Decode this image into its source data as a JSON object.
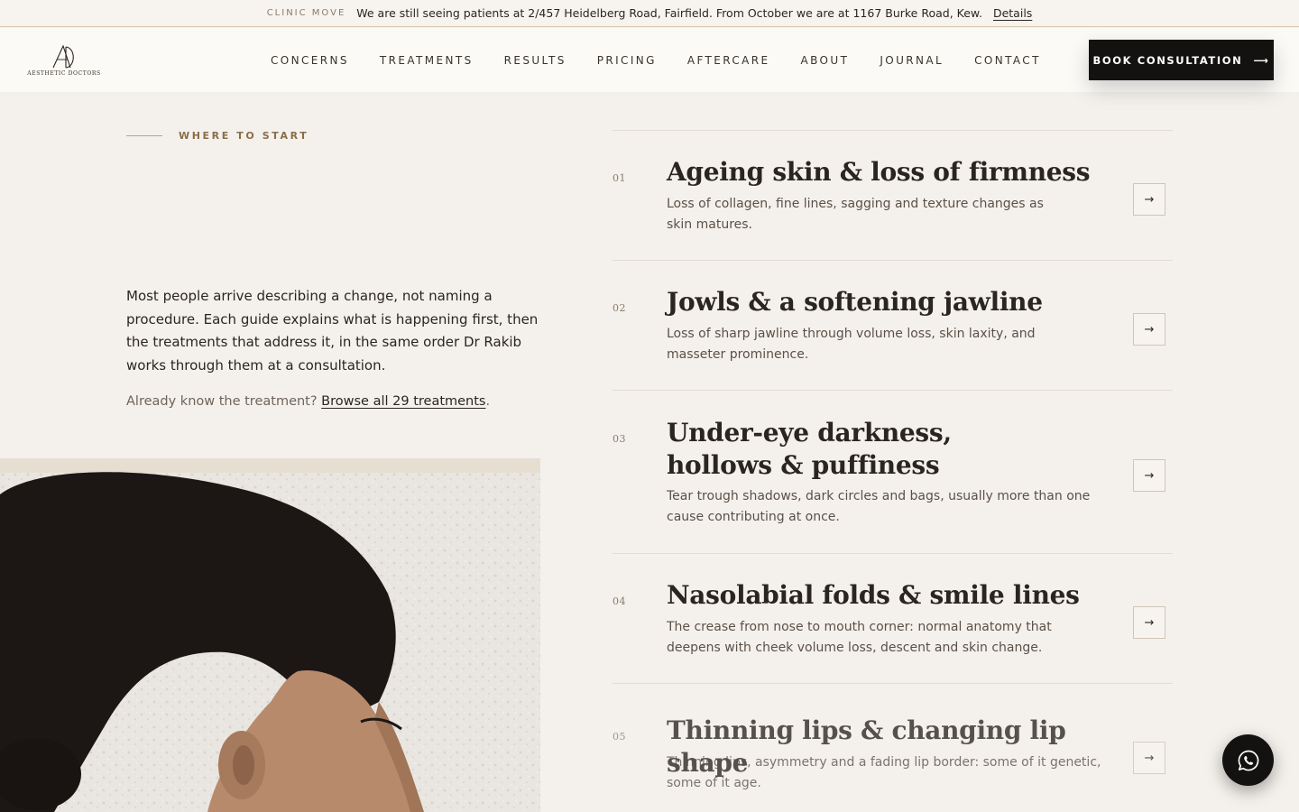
{
  "announcement": {
    "tag": "CLINIC MOVE",
    "message": "We are still seeing patients at 2/457 Heidelberg Road, Fairfield. From October we are at 1167 Burke Road, Kew.",
    "link": "Details"
  },
  "header": {
    "logo": {
      "monogram": "AD",
      "name": "AESTHETIC DOCTORS"
    },
    "nav": [
      "CONCERNS",
      "TREATMENTS",
      "RESULTS",
      "PRICING",
      "AFTERCARE",
      "ABOUT",
      "JOURNAL",
      "CONTACT"
    ],
    "cta": "BOOK CONSULTATION",
    "cta_icon": "arrow-right-icon"
  },
  "intro": {
    "eyebrow": "WHERE TO START",
    "paragraph": "Most people arrive describing a change, not naming a procedure. Each guide explains what is happening first, then the treatments that address it, in the same order Dr Rakib works through them at a consultation.",
    "browse_prefix": "Already know the treatment? ",
    "browse_link": "Browse all 29 treatments",
    "browse_suffix": "."
  },
  "concerns": [
    {
      "number": "01",
      "title": "Ageing skin & loss of firmness",
      "description": "Loss of collagen, fine lines, sagging and texture changes as skin matures."
    },
    {
      "number": "02",
      "title": "Jowls & a softening jawline",
      "description": "Loss of sharp jawline through volume loss, skin laxity, and masseter prominence."
    },
    {
      "number": "03",
      "title": "Under-eye darkness, hollows & puffiness",
      "description": "Tear trough shadows, dark circles and bags, usually more than one cause contributing at once."
    },
    {
      "number": "04",
      "title": "Nasolabial folds & smile lines",
      "description": "The crease from nose to mouth corner: normal anatomy that deepens with cheek volume loss, descent and skin change."
    },
    {
      "number": "05",
      "title": "Thinning lips & changing lip shape",
      "description": "Thinning lips, asymmetry and a fading lip border: some of it genetic, some of it age."
    }
  ],
  "icons": {
    "concern_arrow": "arrow-right-icon",
    "float": "whatsapp-icon"
  },
  "colors": {
    "accent": "#8a6d4a",
    "dark": "#141210",
    "background": "#f4f1ec"
  }
}
